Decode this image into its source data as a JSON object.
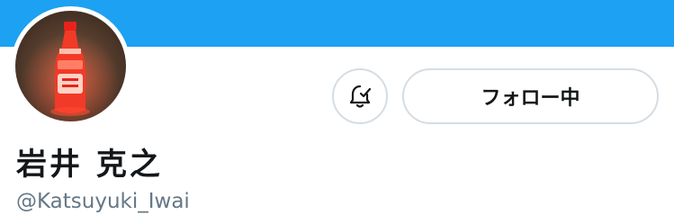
{
  "colors": {
    "banner": "#1da1f2",
    "border": "#d4dde4",
    "text_primary": "#14171a",
    "text_secondary": "#657786"
  },
  "profile": {
    "display_name": "岩井 克之",
    "handle": "@Katsuyuki_Iwai",
    "avatar_icon": "mayonnaise-bottle-photo"
  },
  "actions": {
    "notify_icon": "bell-check-icon",
    "follow_label": "フォロー中"
  }
}
